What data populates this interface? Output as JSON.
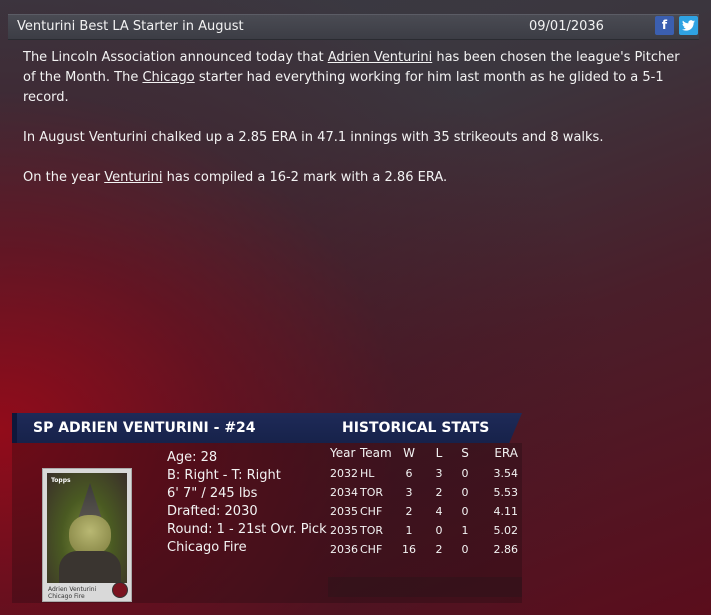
{
  "header": {
    "headline": "Venturini Best LA Starter in August",
    "date": "09/01/2036",
    "facebook_glyph": "f",
    "twitter_glyph": "🐦"
  },
  "article": {
    "p1": {
      "t1": "The Lincoln Association announced today that ",
      "link1": "Adrien Venturini",
      "t2": " has been chosen the league's Pitcher of the Month. The ",
      "link2": "Chicago",
      "t3": " starter had everything working for him last month as he glided to a 5-1 record."
    },
    "p2": "In August Venturini chalked up a 2.85 ERA in 47.1 innings with 35 strikeouts and 8 walks.",
    "p3": {
      "t1": "On the year ",
      "link1": "Venturini",
      "t2": " has compiled a 16-2 mark with a 2.86 ERA."
    }
  },
  "player": {
    "title": "SP ADRIEN VENTURINI - #24",
    "age": "Age: 28",
    "bats_throws": "B: Right - T: Right",
    "height_weight": "6' 7\" / 245 lbs",
    "drafted": "Drafted: 2030",
    "round": "Round: 1 - 21st Ovr. Pick",
    "team": "Chicago Fire",
    "card_name": "Adrien Venturini",
    "card_team": "Chicago Fire",
    "card_brand": "Topps"
  },
  "stats": {
    "title": "HISTORICAL STATS",
    "headers": {
      "year": "Year",
      "team": "Team",
      "w": "W",
      "l": "L",
      "s": "S",
      "era": "ERA"
    },
    "rows": [
      {
        "year": "2032",
        "team": "HL",
        "w": "6",
        "l": "3",
        "s": "0",
        "era": "3.54"
      },
      {
        "year": "2034",
        "team": "TOR",
        "w": "3",
        "l": "2",
        "s": "0",
        "era": "5.53"
      },
      {
        "year": "2035",
        "team": "CHF",
        "w": "2",
        "l": "4",
        "s": "0",
        "era": "4.11"
      },
      {
        "year": "2035",
        "team": "TOR",
        "w": "1",
        "l": "0",
        "s": "1",
        "era": "5.02"
      },
      {
        "year": "2036",
        "team": "CHF",
        "w": "16",
        "l": "2",
        "s": "0",
        "era": "2.86"
      }
    ]
  }
}
